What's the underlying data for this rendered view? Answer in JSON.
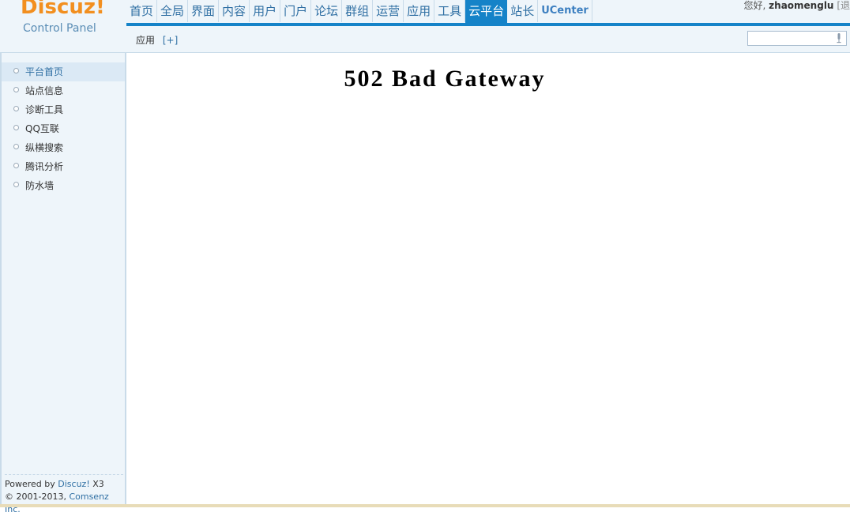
{
  "logo": {
    "brand": "Discuz!",
    "subtitle": "Control Panel"
  },
  "nav": {
    "items": [
      {
        "label": "首页"
      },
      {
        "label": "全局"
      },
      {
        "label": "界面"
      },
      {
        "label": "内容"
      },
      {
        "label": "用户"
      },
      {
        "label": "门户"
      },
      {
        "label": "论坛"
      },
      {
        "label": "群组"
      },
      {
        "label": "运营"
      },
      {
        "label": "应用"
      },
      {
        "label": "工具"
      },
      {
        "label": "云平台",
        "active": true
      },
      {
        "label": "站长"
      },
      {
        "label": "UCenter"
      }
    ]
  },
  "header": {
    "greeting_prefix": "您好,",
    "username": "zhaomenglu",
    "logout_fragment": "[退"
  },
  "subnav": {
    "label": "应用",
    "add_label": "[+]"
  },
  "search": {
    "value": "",
    "mic_icon": "microphone-icon"
  },
  "sidebar": {
    "items": [
      {
        "label": "平台首页",
        "active": true
      },
      {
        "label": "站点信息"
      },
      {
        "label": "诊断工具"
      },
      {
        "label": "QQ互联"
      },
      {
        "label": "纵横搜索"
      },
      {
        "label": "腾讯分析"
      },
      {
        "label": "防水墙"
      }
    ],
    "footer": {
      "powered_prefix": "Powered by ",
      "powered_link": "Discuz!",
      "powered_version": " X3",
      "copyright_prefix": "© 2001-2013, ",
      "copyright_link": "Comsenz Inc."
    }
  },
  "main": {
    "error_title": "502 Bad Gateway"
  },
  "colors": {
    "accent": "#1583c8",
    "brand": "#f28f1f",
    "sidebar_bg": "#eef5fa"
  }
}
